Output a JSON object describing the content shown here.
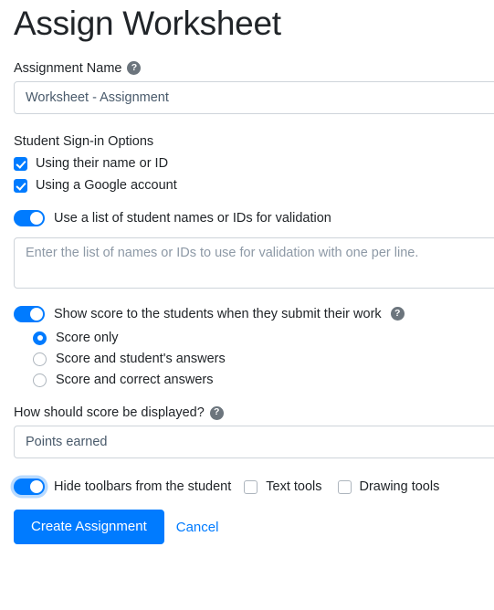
{
  "page": {
    "title": "Assign Worksheet"
  },
  "assignment_name": {
    "label": "Assignment Name",
    "help_icon": "?",
    "value": "Worksheet - Assignment",
    "placeholder": "Worksheet - Assignment"
  },
  "signin": {
    "group_label": "Student Sign-in Options",
    "options": [
      {
        "label": "Using their name or ID",
        "checked": true
      },
      {
        "label": "Using a Google account",
        "checked": true
      }
    ]
  },
  "validation": {
    "toggle_label": "Use a list of student names or IDs for validation",
    "toggle_on": true,
    "textarea_value": "",
    "textarea_placeholder": "Enter the list of names or IDs to use for validation with one per line."
  },
  "show_score": {
    "toggle_label": "Show score to the students when they submit their work",
    "toggle_on": true,
    "help_icon": "?",
    "radio_options": [
      {
        "label": "Score only",
        "selected": true
      },
      {
        "label": "Score and student's answers",
        "selected": false
      },
      {
        "label": "Score and correct answers",
        "selected": false
      }
    ]
  },
  "score_display": {
    "label": "How should score be displayed?",
    "help_icon": "?",
    "value": "Points earned"
  },
  "toolbars": {
    "toggle_label": "Hide toolbars from the student",
    "toggle_on": true,
    "toggle_focused": true,
    "checkboxes": [
      {
        "label": "Text tools",
        "checked": false
      },
      {
        "label": "Drawing tools",
        "checked": false
      }
    ]
  },
  "actions": {
    "submit_label": "Create Assignment",
    "cancel_label": "Cancel"
  },
  "colors": {
    "primary": "#007bff",
    "help_icon_bg": "#6c757d",
    "border": "#ced4da",
    "text": "#212529",
    "placeholder": "#8d99a6"
  }
}
